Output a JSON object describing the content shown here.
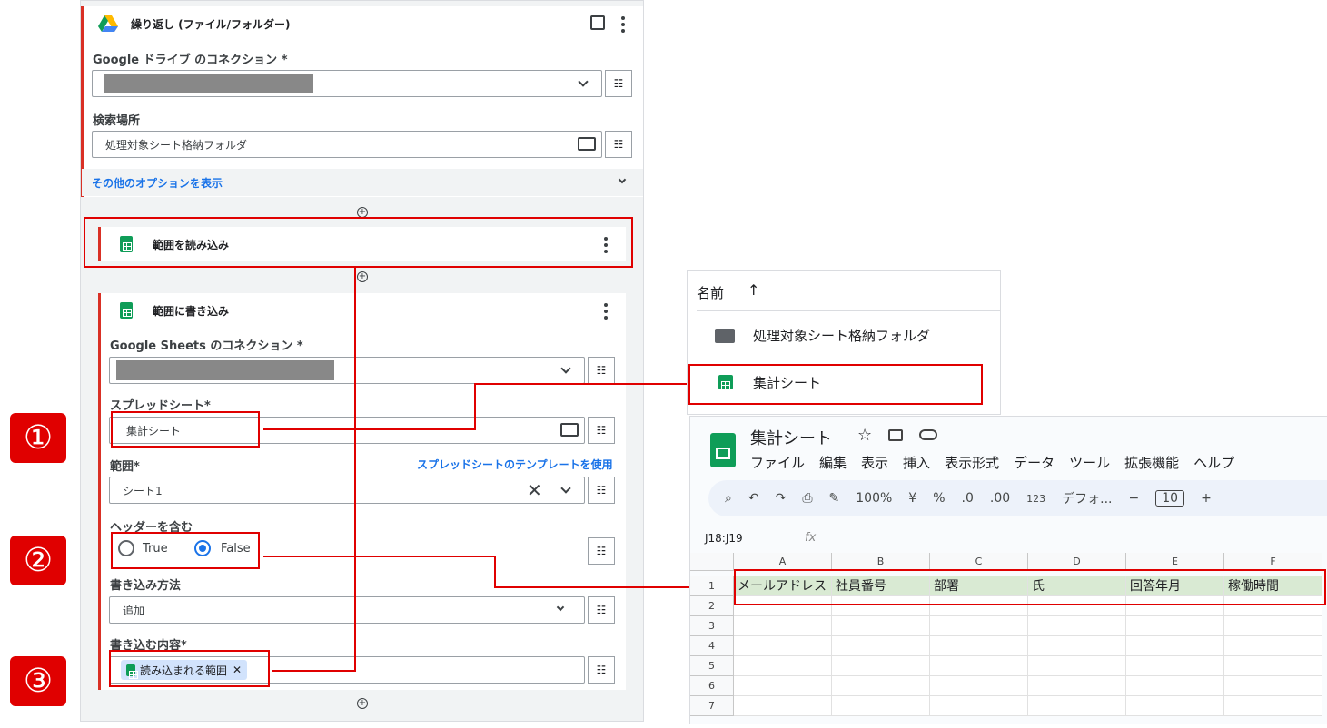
{
  "loop_card": {
    "title": "繰り返し (ファイル/フォルダー)",
    "drive_connection_label": "Google ドライブ のコネクション *",
    "search_location_label": "検索場所",
    "search_location_value": "処理対象シート格納フォルダ",
    "more_options": "その他のオプションを表示"
  },
  "read_card": {
    "title": "範囲を読み込み"
  },
  "write_card": {
    "title": "範囲に書き込み",
    "sheets_connection_label": "Google Sheets のコネクション *",
    "spreadsheet_label": "スプレッドシート*",
    "spreadsheet_value": "集計シート",
    "range_label": "範囲*",
    "template_link": "スプレッドシートのテンプレートを使用",
    "range_value": "シート1",
    "header_label": "ヘッダーを含む",
    "radio_true": "True",
    "radio_false": "False",
    "radio_selected": "False",
    "write_method_label": "書き込み方法",
    "write_method_value": "追加",
    "content_label": "書き込む内容*",
    "content_chip": "読み込まれる範囲"
  },
  "markers": [
    "①",
    "②",
    "③"
  ],
  "drive_list": {
    "col_name": "名前",
    "sort_icon": "↑",
    "items": [
      {
        "name": "処理対象シート格納フォルダ",
        "icon": "folder-icon"
      },
      {
        "name": "集計シート",
        "icon": "sheets-icon"
      }
    ]
  },
  "sheets": {
    "doc_title": "集計シート",
    "menu": [
      "ファイル",
      "編集",
      "表示",
      "挿入",
      "表示形式",
      "データ",
      "ツール",
      "拡張機能",
      "ヘルプ"
    ],
    "toolbar": {
      "zoom": "100%",
      "currency": "¥",
      "percent": "%",
      "dec_dec": ".0",
      "dec_inc": ".00",
      "num": "123",
      "font": "デフォ...",
      "font_size": "10"
    },
    "name_box": "J18:J19",
    "fx": "fx",
    "columns": [
      "A",
      "B",
      "C",
      "D",
      "E",
      "F"
    ],
    "rows": [
      "1",
      "2",
      "3",
      "4",
      "5",
      "6",
      "7"
    ],
    "header_row": [
      "メールアドレス",
      "社員番号",
      "部署",
      "氏",
      "回答年月",
      "稼働時間"
    ]
  },
  "colors": {
    "accent_red": "#e00000",
    "link_blue": "#1a73e8",
    "sheets_green": "#0f9d58",
    "header_fill": "#d9ead3"
  }
}
